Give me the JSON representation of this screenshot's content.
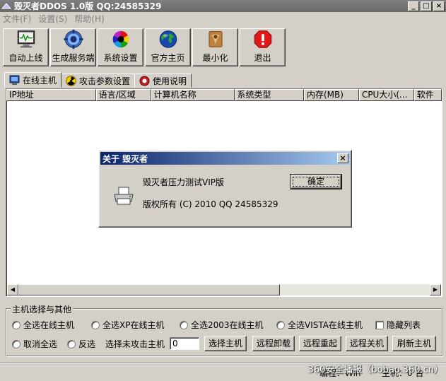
{
  "window": {
    "title": "毁灭者DDOS 1.0版 QQ:24585329",
    "minimize": "_",
    "maximize": "□",
    "close": "×"
  },
  "menu": [
    "文件(F)",
    "设置(S)",
    "帮助(H)"
  ],
  "toolbar": [
    {
      "label": "自动上线",
      "icon": "monitor-icon"
    },
    {
      "label": "生成服务端",
      "icon": "gear-icon"
    },
    {
      "label": "系统设置",
      "icon": "color-wheel-icon"
    },
    {
      "label": "官方主页",
      "icon": "globe-icon"
    },
    {
      "label": "最小化",
      "icon": "minimize-icon"
    },
    {
      "label": "退出",
      "icon": "stop-icon"
    }
  ],
  "tabs": [
    {
      "label": "在线主机",
      "icon": "monitor-icon"
    },
    {
      "label": "攻击参数设置",
      "icon": "radiation-icon"
    },
    {
      "label": "使用说明",
      "icon": "help-icon"
    }
  ],
  "columns": [
    {
      "label": "IP地址"
    },
    {
      "label": "语言/区域"
    },
    {
      "label": "计算机名称"
    },
    {
      "label": "系统类型"
    },
    {
      "label": "内存(MB)"
    },
    {
      "label": "CPU大小(..."
    },
    {
      "label": "软件"
    }
  ],
  "group": {
    "title": "主机选择与其他",
    "options_row1": [
      "全选在线主机",
      "全选XP在线主机",
      "全选2003在线主机",
      "全选VISTA在线主机"
    ],
    "hide_list": "隐藏列表",
    "deselect_all": "取消全选",
    "invert": "反选",
    "select_unattacked_label": "选择未攻击主机",
    "count_value": "0",
    "buttons": [
      "选择主机",
      "远程卸载",
      "远程重起",
      "远程关机",
      "刷新主机"
    ]
  },
  "status": {
    "left": "编程：Win",
    "right": "主机：0 台",
    "watermark": "360安全播报（bobao.360.cn）"
  },
  "dialog": {
    "title": "关于 毁灭者",
    "line1": "毁灭者压力测试VIP版",
    "line2": "版权所有  (C) 2010    QQ 24585329",
    "ok": "确定",
    "close": "×"
  }
}
